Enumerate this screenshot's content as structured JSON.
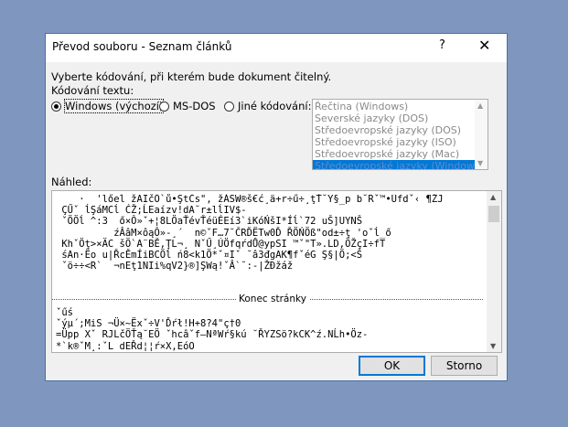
{
  "dialog": {
    "title": "Převod souboru - Seznam článků",
    "help": "?",
    "close": "✕",
    "description": "Vyberte kódování, při kterém bude dokument čitelný.",
    "encoding_label": "Kódování textu:",
    "radios": [
      {
        "label": "Windows (výchozí)",
        "selected": true
      },
      {
        "label": "MS-DOS",
        "selected": false
      },
      {
        "label": "Jiné kódování:",
        "selected": false
      }
    ],
    "encodings": [
      "Řečtina (Windows)",
      "Severské jazyky (DOS)",
      "Středoevropské jazyky (DOS)",
      "Středoevropské jazyky (ISO)",
      "Středoevropské jazyky (Mac)",
      "Středoevropské jazyky (Windows)"
    ],
    "selected_encoding": "Středoevropské jazyky (Windows)",
    "preview_label": "Náhled:",
    "preview_lines_top": [
      "    ·  'lőeĺ žAIčÖ`ů•ŞtČs\", žÁSW®š€ć¸ä+r÷ű÷¸ţŤ˘Y§_p b˘Rˇ™•Üfdˇ‹ ¶ŽJ",
      " ÇŰˇ ĺŞáMCĺ ĆŽ;ĹEaízv!dA˘r±lĺIV$-",
      " ˇÖÖĺ ^:3  ő×Ô»ˇ+¦8LÖaŤévŤéüÉEí3`iKóŃšI*Íĺ`72 uŠ]UYNŠ",
      "          źÂâM×ôąÔ»-¸´  n©ˇF…7˘ČRĎËTw0Ď ŘÖŃÖß\"od±÷ţ 'oˇĺ_ő",
      " KhˇÖţ>×ÄC šÖ`A¨BĚ,ŢL¬¸ NˇŰ¸ÚÖfqŕdŮ@ypSI ™ˇ\"T».LD,ÖŽçI÷fT",
      " śAn·Ëo u|ŘcĚmÍiBCÖĺ ń8<k1Ö*ˇ¤Iˇ ˘â3đgAK¶fˇéG Ş§|Ö;<Š",
      " ˇö÷÷<R`  ¬nEţ1NIi%qV2}®]ŞWą!ˇÂ`˘:-|ŽĐžáž"
    ],
    "page_break": "Konec stránky",
    "preview_lines_bottom": [
      "ˇűś",
      "ˇýµ´;MiS ¬Ü×~Ëxˇ÷V'Ďŕł!H+8?4\"ç†0",
      "=Üpp Xˇ RJLčÖŤą˘EÖ ˇhcâˇf—NªWŕ§kú ˘ŘYZSö?kCK^ź.NĹh•Öz-",
      "*`k®ˇM¸:ˇL dEŘd¦¦ŕ×X,EóO"
    ],
    "ok_label": "OK",
    "cancel_label": "Storno"
  }
}
